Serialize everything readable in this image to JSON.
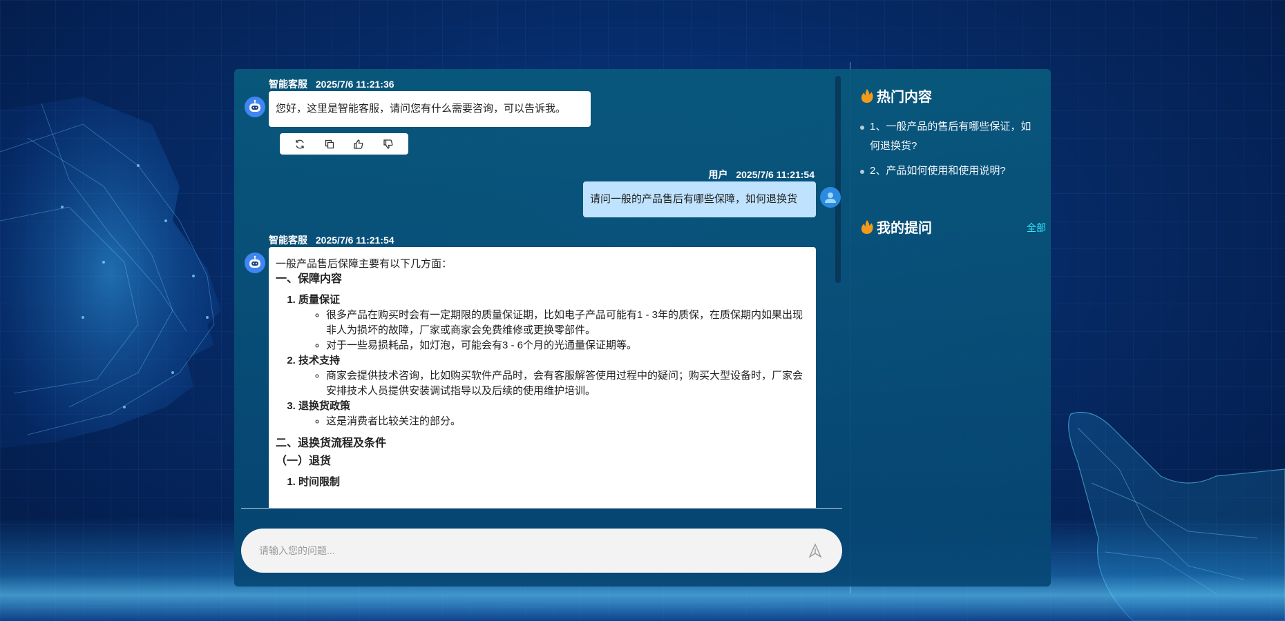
{
  "chat": {
    "messages": [
      {
        "role": "bot",
        "sender": "智能客服",
        "time": "2025/7/6 11:21:36",
        "text": "您好，这里是智能客服，请问您有什么需要咨询，可以告诉我。"
      },
      {
        "role": "user",
        "sender": "用户",
        "time": "2025/7/6 11:21:54",
        "text": "请问一般的产品售后有哪些保障，如何退换货"
      },
      {
        "role": "bot",
        "sender": "智能客服",
        "time": "2025/7/6 11:21:54",
        "intro": "一般产品售后保障主要有以下几方面：",
        "section1": "一、保障内容",
        "items": [
          {
            "title": "质量保证",
            "points": [
              "很多产品在购买时会有一定期限的质量保证期，比如电子产品可能有1 - 3年的质保，在质保期内如果出现非人为损坏的故障，厂家或商家会免费维修或更换零部件。",
              "对于一些易损耗品，如灯泡，可能会有3 - 6个月的光通量保证期等。"
            ]
          },
          {
            "title": "技术支持",
            "points": [
              "商家会提供技术咨询，比如购买软件产品时，会有客服解答使用过程中的疑问；购买大型设备时，厂家会安排技术人员提供安装调试指导以及后续的使用维护培训。"
            ]
          },
          {
            "title": "退换货政策",
            "points": [
              "这是消费者比较关注的部分。"
            ]
          }
        ],
        "section2": "二、退换货流程及条件",
        "sub1": "（一）退货",
        "sub_item1": "时间限制"
      }
    ],
    "actions": [
      "refresh-icon",
      "copy-icon",
      "thumbs-up-icon",
      "thumbs-down-icon"
    ]
  },
  "input": {
    "placeholder": "请输入您的问题..."
  },
  "sidebar": {
    "hot_title": "热门内容",
    "hot_items": [
      "1、一般产品的售后有哪些保证，如何退换货?",
      "2、产品如何使用和使用说明?"
    ],
    "my_title": "我的提问",
    "all_label": "全部"
  },
  "colors": {
    "accent_link": "#2ee6ff",
    "user_bubble": "#bfe3ff",
    "bot_avatar": "#3f86f2",
    "fire_icon": "#f29a1c"
  }
}
